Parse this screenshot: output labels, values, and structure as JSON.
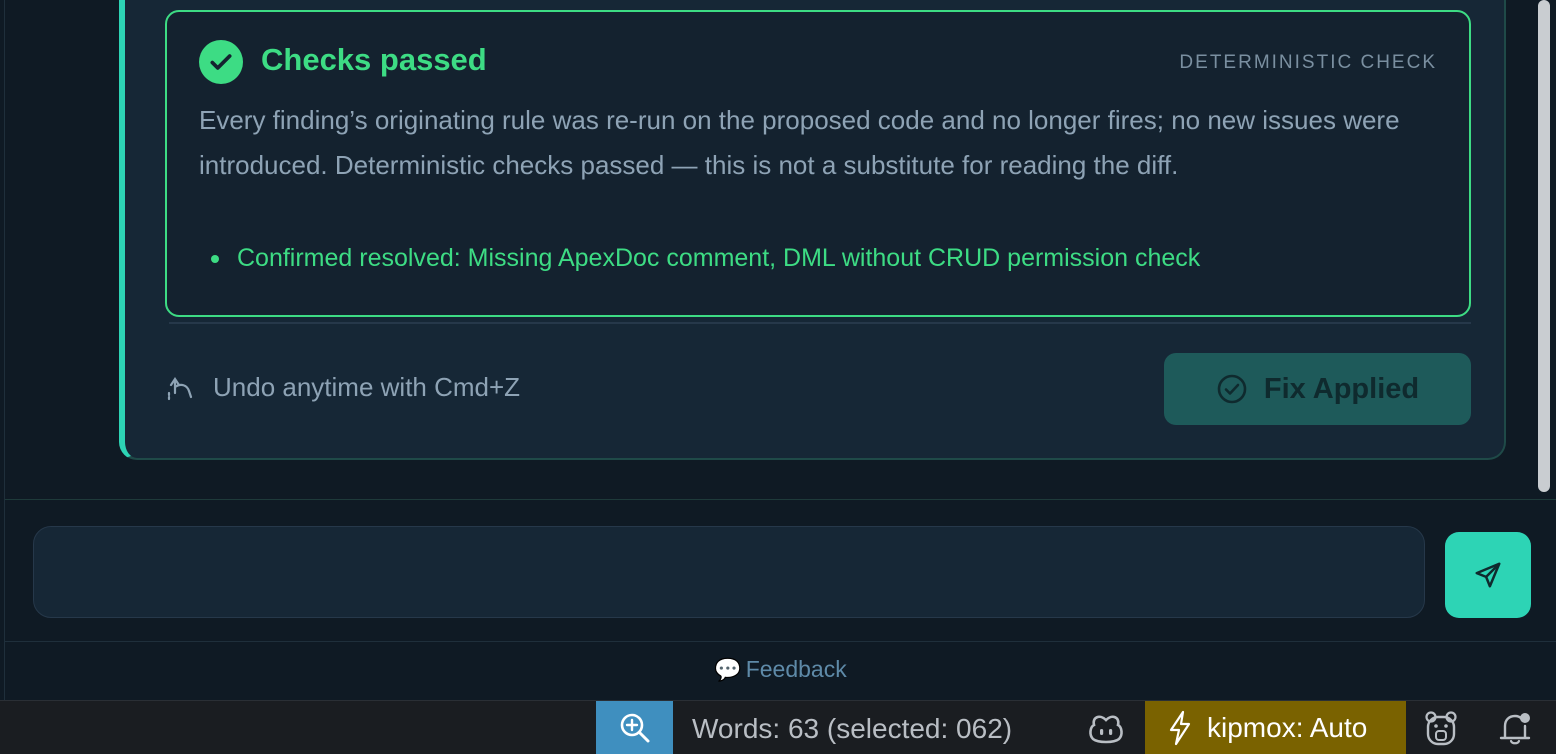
{
  "fix_card": {
    "check": {
      "title": "Checks passed",
      "kind": "DETERMINISTIC CHECK",
      "body": "Every finding’s originating rule was re-run on the proposed code and no longer fires; no new issues were introduced. Deterministic checks passed — this is not a substitute for reading the diff.",
      "items": [
        "Confirmed resolved: Missing ApexDoc comment, DML without CRUD permission check"
      ]
    },
    "undo_hint": "Undo anytime with Cmd+Z",
    "fix_button_label": "Fix Applied"
  },
  "chat_input": {
    "value": "",
    "placeholder": ""
  },
  "feedback": {
    "icon": "💬",
    "label": "Feedback"
  },
  "status_bar": {
    "words": "Words: 63 (selected: 062)",
    "kipmox": "kipmox: Auto"
  },
  "colors": {
    "accent": "#2dd4b5",
    "success": "#3ddc84",
    "zoom_bg": "#3f8fbf",
    "kipmox_bg": "#7a6200"
  },
  "icons": [
    "check-circle-icon",
    "undo-icon",
    "check-outline-icon",
    "send-icon",
    "zoom-in-icon",
    "copilot-icon",
    "lightning-icon",
    "bear-icon",
    "bell-icon"
  ]
}
